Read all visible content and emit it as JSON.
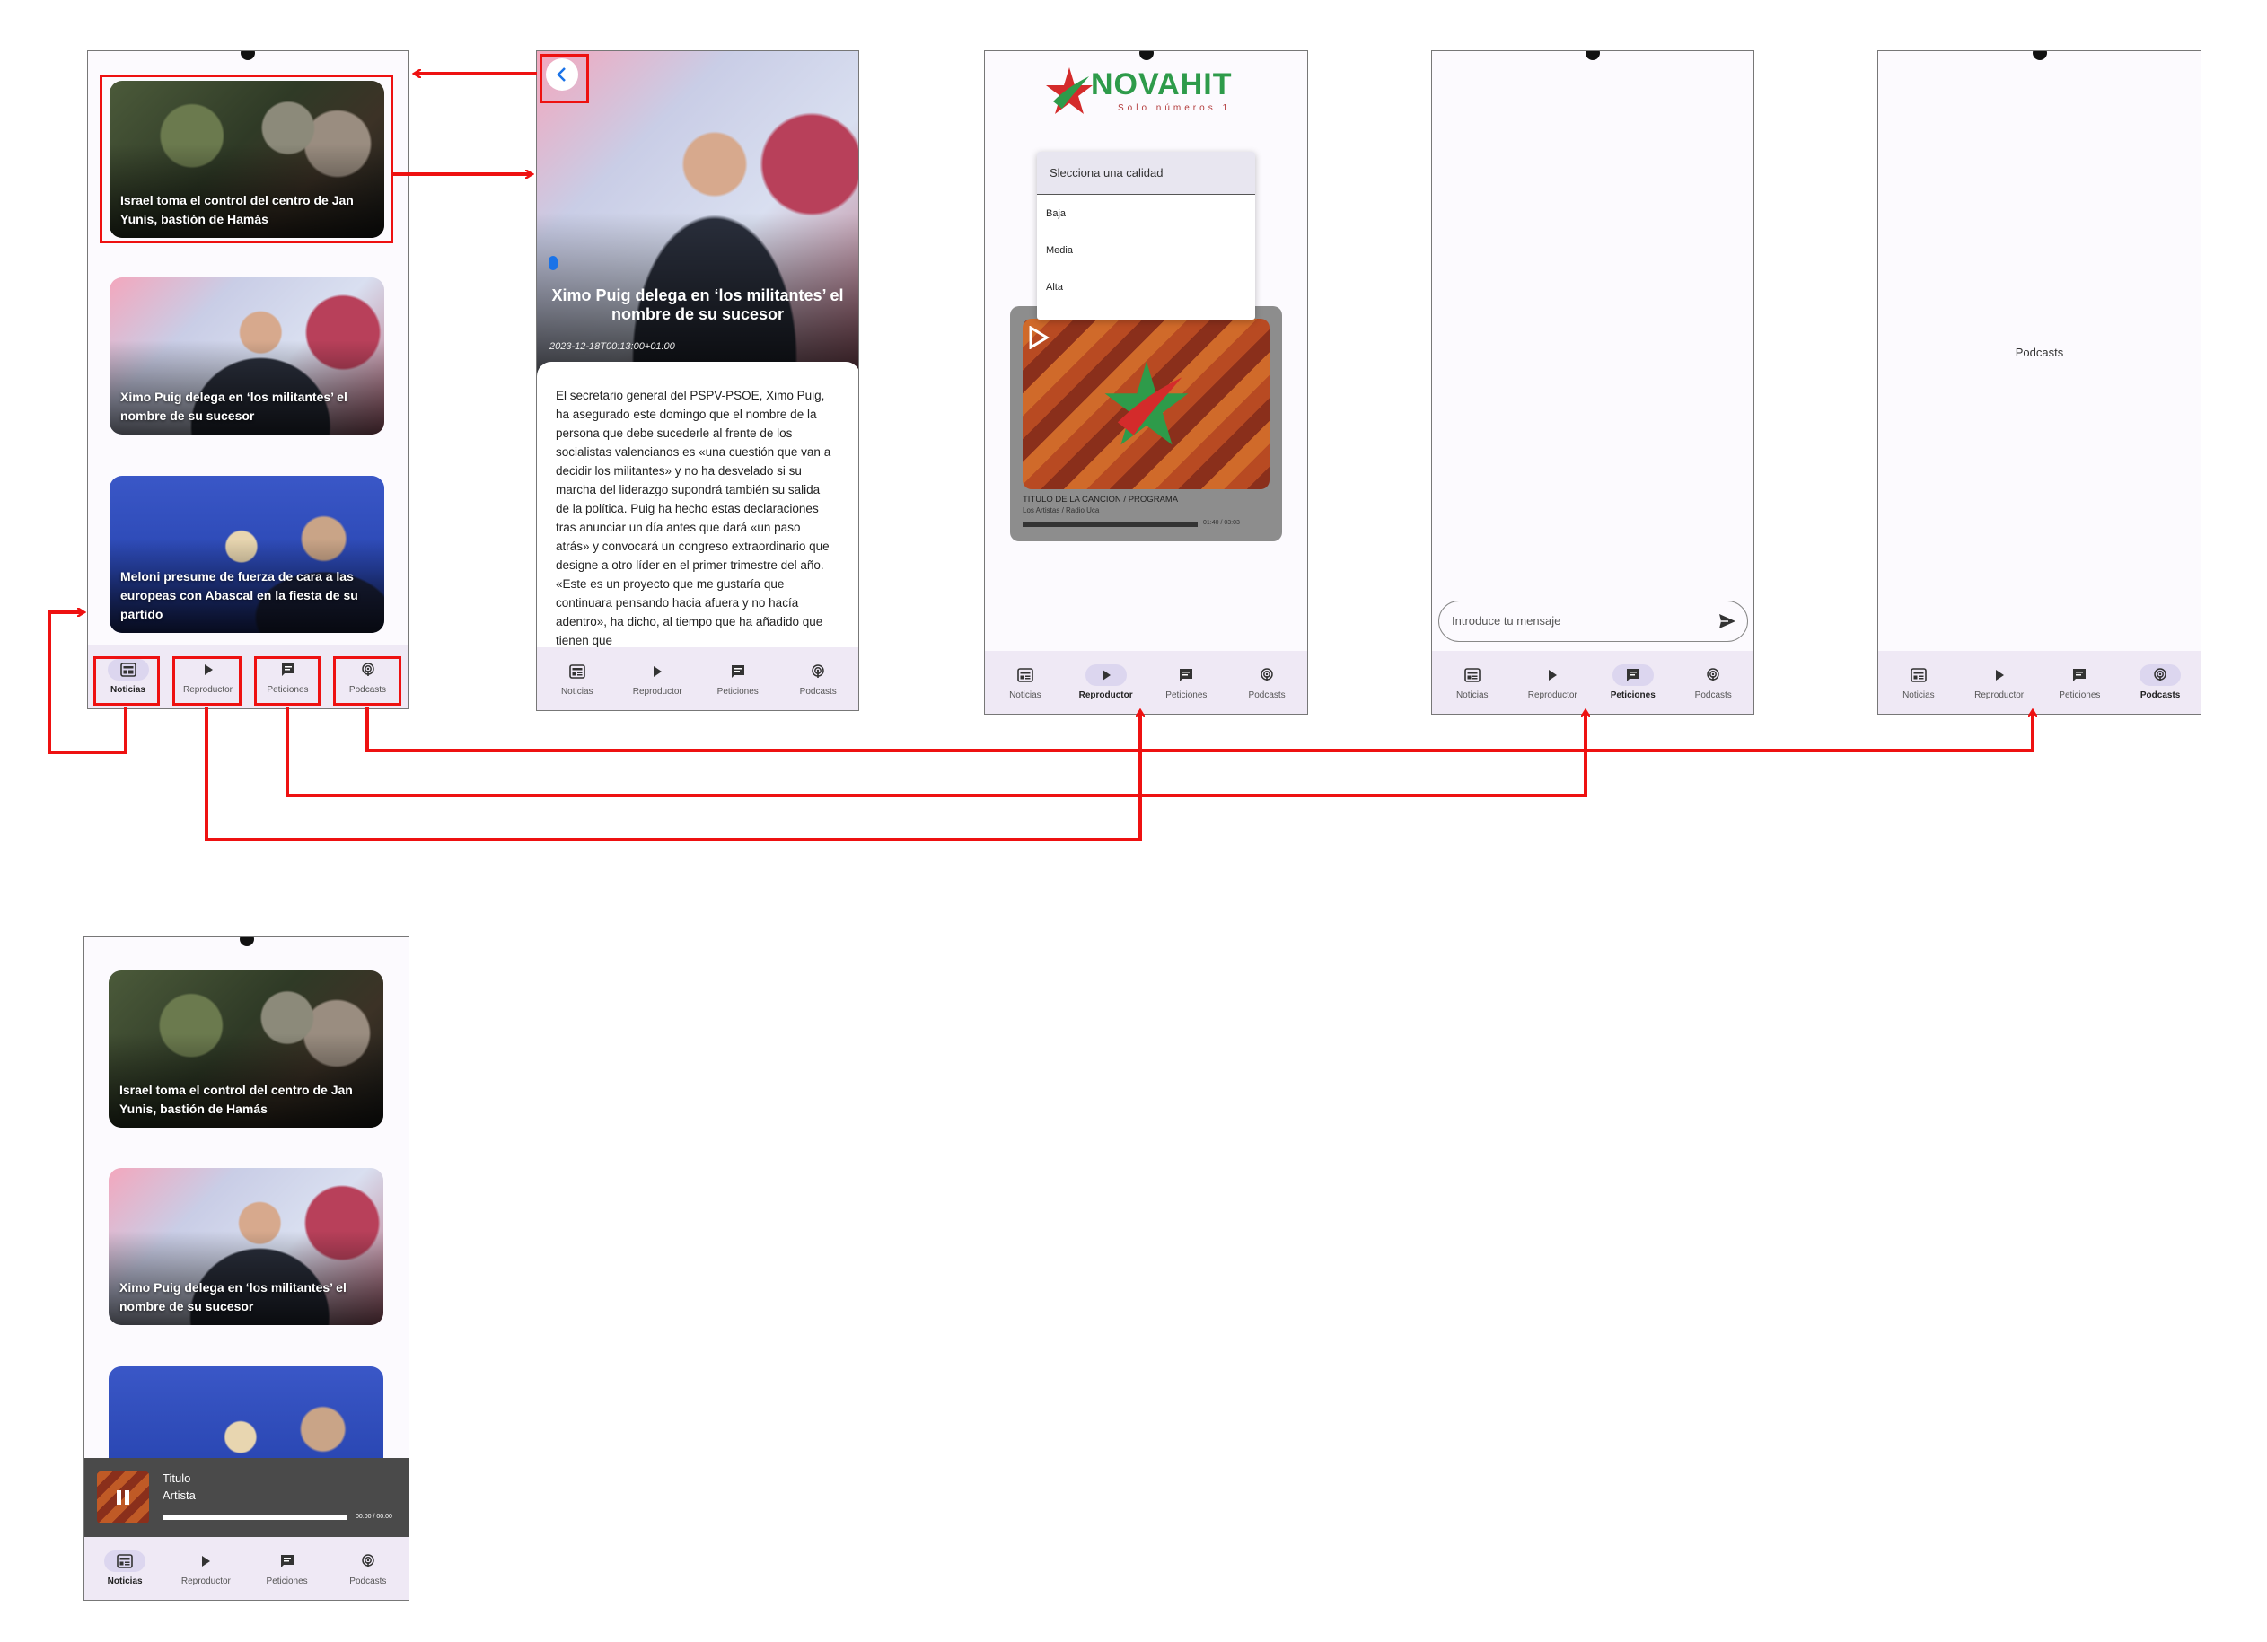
{
  "nav": {
    "labels": [
      "Noticias",
      "Reproductor",
      "Peticiones",
      "Podcasts"
    ]
  },
  "news": [
    {
      "title": "Israel toma el control del centro de Jan Yunis, bastión de Hamás"
    },
    {
      "title": "Ximo Puig delega en ‘los militantes’ el nombre de su sucesor"
    },
    {
      "title": "Meloni presume de fuerza de cara a las europeas con Abascal en la fiesta de su partido"
    }
  ],
  "article": {
    "title": "Ximo Puig delega en ‘los militantes’ el nombre de su sucesor",
    "datetime": "2023-12-18T00:13:00+01:00",
    "body": "El secretario general del PSPV-PSOE, Ximo Puig, ha asegurado este domingo que el nombre de la persona que debe sucederle al frente de los socialistas valencianos es «una cuestión que van a decidir los militantes» y no ha desvelado si su marcha del liderazgo supondrá también su salida de la política. Puig ha hecho estas declaraciones tras anunciar un día antes que dará «un paso atrás» y convocará un congreso extraordinario que designe a otro líder en el primer trimestre del año. «Este es un proyecto que me gustaría que continuara pensando hacia afuera y no hacía adentro», ha dicho, al tiempo que ha añadido que tienen que"
  },
  "player": {
    "logo_text": "NOVAHIT",
    "logo_tagline": "Solo números 1",
    "quality_label": "Slecciona una calidad",
    "quality_options": [
      "Baja",
      "Media",
      "Alta"
    ],
    "track_title": "TITULO DE LA CANCION / PROGRAMA",
    "track_subtitle": "Los Artistas / Radio Uca",
    "time": "01:40 / 03:03"
  },
  "requests": {
    "input_placeholder": "Introduce tu mensaje"
  },
  "podcasts": {
    "label": "Podcasts"
  },
  "mini_player": {
    "title": "Titulo",
    "artist": "Artista",
    "time": "00:00 / 00:00"
  },
  "colors": {
    "arrow": "#ee1111",
    "nav_bg": "#efe9f5",
    "active_pill": "#dcd6ef",
    "brand_green": "#2e9b4a",
    "brand_red": "#d42b2b"
  }
}
